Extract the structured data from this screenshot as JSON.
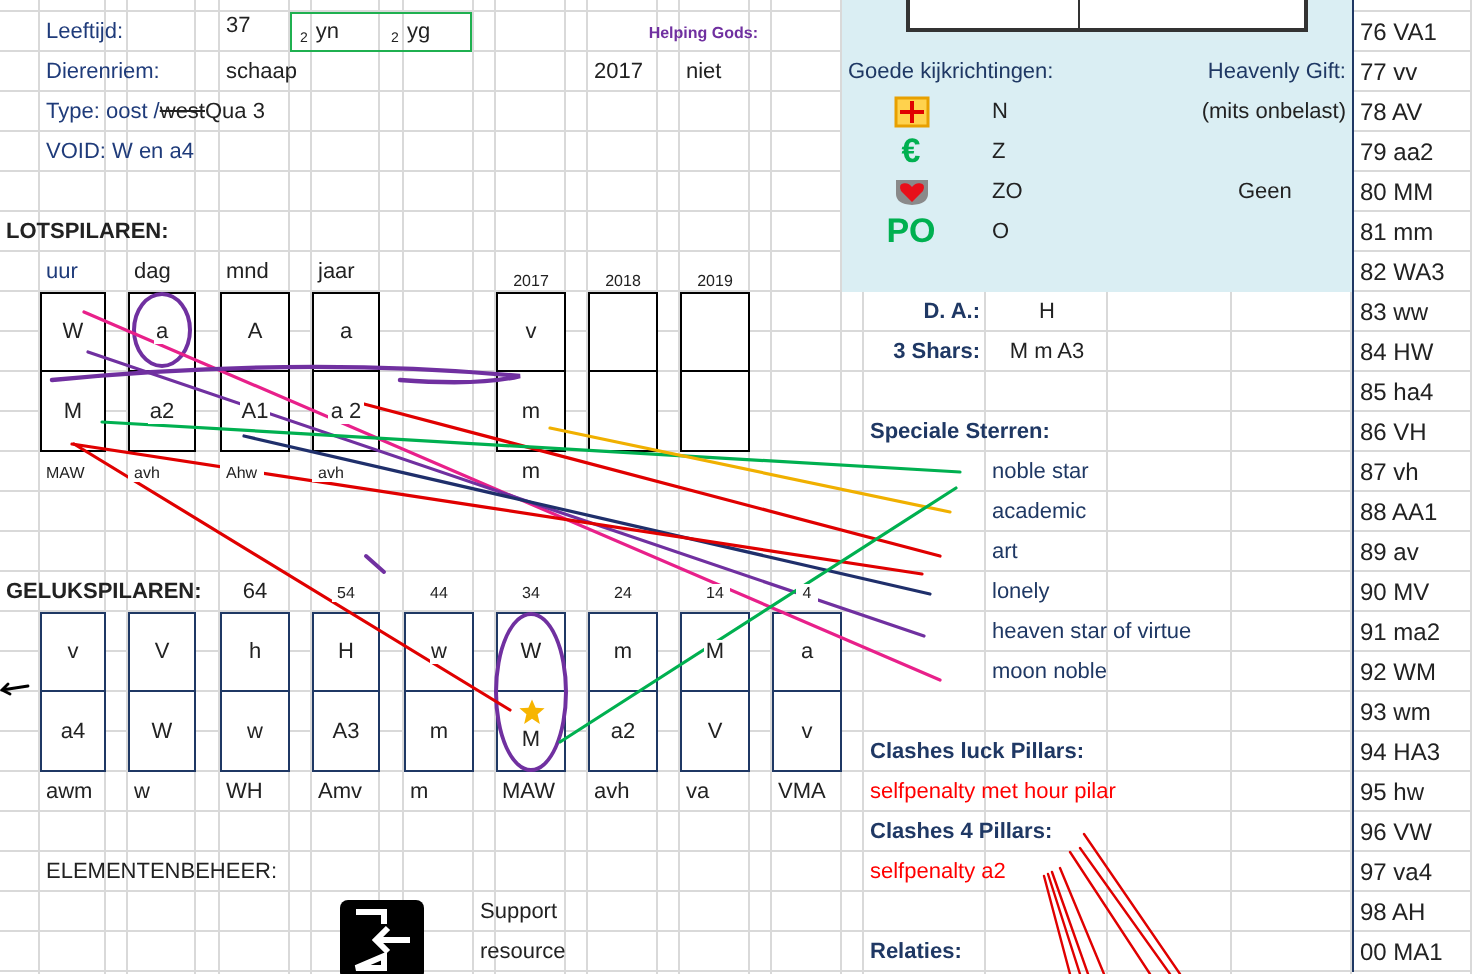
{
  "personal": {
    "age_label": "Leeftijd:",
    "age": "37",
    "age_box": [
      {
        "number": "2",
        "text": "yn"
      },
      {
        "number": "2",
        "text": "yg"
      }
    ],
    "helping_gods_label": "Helping Gods:",
    "zodiac_label": "Dierenriem:",
    "zodiac": "schaap",
    "year": "2017",
    "year_status": "niet",
    "type_line": [
      {
        "kind": "label",
        "text": "Type: oost /"
      },
      {
        "kind": "struck",
        "text": "west"
      },
      {
        "kind": "plain",
        "text": "Qua 3"
      }
    ],
    "void": "VOID: W en a4"
  },
  "fate_pillars": {
    "title": "LOTSPILAREN:",
    "columns": [
      {
        "heading": "uur",
        "top": "W",
        "bottom": "M",
        "note": "MAW",
        "circled": false
      },
      {
        "heading": "dag",
        "top": "a",
        "bottom": "a2",
        "note": "avh",
        "circled": true
      },
      {
        "heading": "mnd",
        "top": "A",
        "bottom": "A1",
        "note": "Ahw",
        "circled": false
      },
      {
        "heading": "jaar",
        "top": "a",
        "bottom": "a 2",
        "note": "avh",
        "circled": false
      }
    ],
    "years": [
      {
        "year": "2017",
        "top": "v",
        "bottom": "m",
        "note": "m"
      },
      {
        "year": "2018"
      },
      {
        "year": "2019"
      }
    ]
  },
  "luck_pillars": {
    "title": "GELUKSPILAREN:",
    "pillars": [
      {
        "top": "v",
        "bottom": "a4",
        "note": "awm",
        "circled": false,
        "starred": false
      },
      {
        "top": "V",
        "bottom": "W",
        "note": "w",
        "circled": false,
        "starred": false
      },
      {
        "age": "64",
        "top": "h",
        "bottom": "w",
        "note": "WH",
        "circled": false,
        "starred": false
      },
      {
        "age": "54",
        "top": "H",
        "bottom": "A3",
        "note": "Amv",
        "circled": false,
        "starred": false
      },
      {
        "age": "44",
        "top": "w",
        "bottom": "m",
        "note": "m",
        "circled": false,
        "starred": false
      },
      {
        "age": "34",
        "top": "W",
        "bottom": "M",
        "note": "MAW",
        "circled": true,
        "starred": true
      },
      {
        "age": "24",
        "top": "m",
        "bottom": "a2",
        "note": "avh",
        "circled": false,
        "starred": false
      },
      {
        "age": "14",
        "top": "M",
        "bottom": "V",
        "note": "va",
        "circled": false,
        "starred": false
      },
      {
        "age": "4",
        "top": "a",
        "bottom": "v",
        "note": "VMA",
        "circled": false,
        "starred": false
      }
    ]
  },
  "elements": {
    "title": "ELEMENTENBEHEER:",
    "support_lines": [
      "Support",
      "resource"
    ]
  },
  "panel": {
    "directions_label": "Goede kijkrichtingen:",
    "gift_label": "Heavenly Gift:",
    "gift_note": "(mits onbelast)",
    "gift_value": "Geen",
    "directions": [
      {
        "kind": "cross",
        "direction": "N"
      },
      {
        "kind": "symbol",
        "symbol": "€",
        "direction": "Z"
      },
      {
        "kind": "heart",
        "direction": "ZO"
      },
      {
        "kind": "symbol",
        "symbol": "PO",
        "direction": "O"
      }
    ]
  },
  "details": {
    "da_label": "D. A.:",
    "da": "H",
    "shars_label": "3 Shars:",
    "shars": "M m A3",
    "special_stars_label": "Speciale Sterren:",
    "special_stars": [
      "noble star",
      "academic",
      "art",
      "lonely",
      "heaven star of virtue",
      "moon noble"
    ],
    "clashes_luck_label": "Clashes luck Pillars:",
    "clashes_luck": "selfpenalty met hour pilar",
    "clashes_four_label": "Clashes 4 Pillars:",
    "clashes_four": "selfpenalty a2",
    "relations_label": "Relaties:"
  },
  "index_list": [
    "76 VA1",
    "77 vv",
    "78 AV",
    "79 aa2",
    "80 MM",
    "81 mm",
    "82 WA3",
    "83 ww",
    "84 HW",
    "85 ha4",
    "86 VH",
    "87 vh",
    "88 AA1",
    "89 av",
    "90 MV",
    "91 ma2",
    "92 WM",
    "93 wm",
    "94 HA3",
    "95 hw",
    "96 VW",
    "97 va4",
    "98 AH",
    "00 MA1"
  ]
}
